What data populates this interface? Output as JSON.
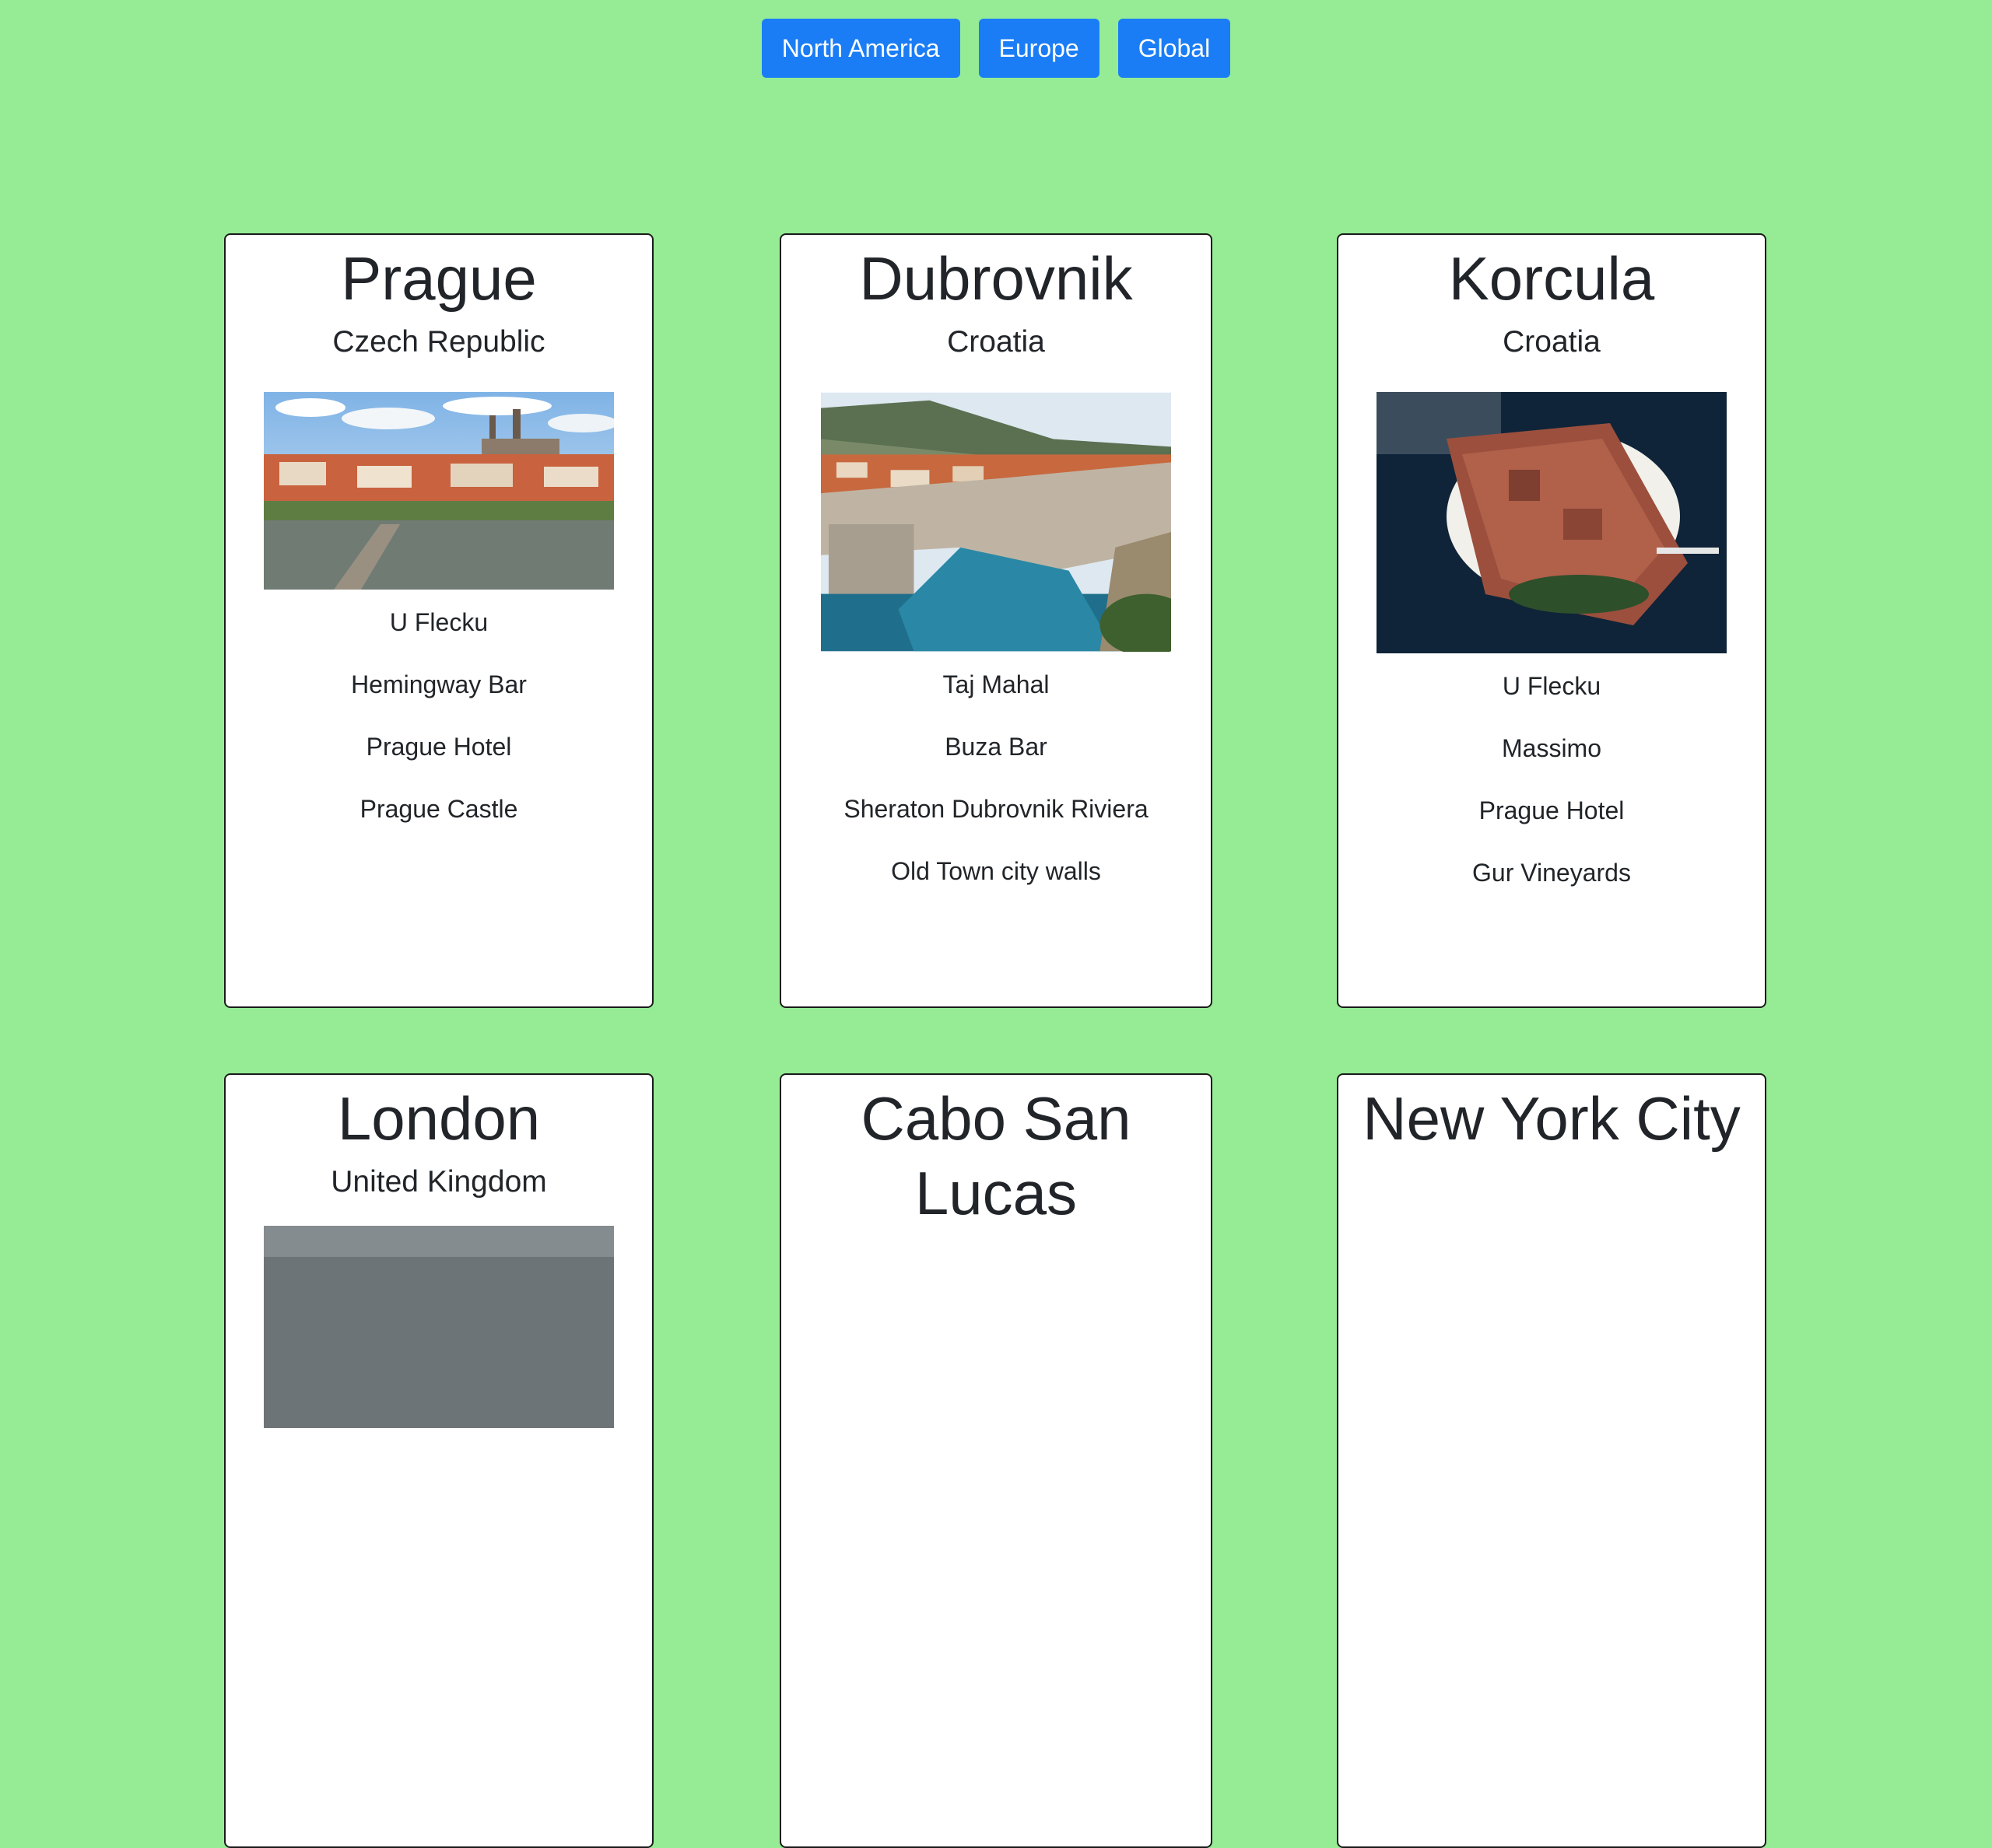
{
  "nav": {
    "buttons": [
      {
        "label": "North America"
      },
      {
        "label": "Europe"
      },
      {
        "label": "Global"
      }
    ]
  },
  "cards": [
    {
      "city": "Prague",
      "country": "Czech Republic",
      "places": [
        "U Flecku",
        "Hemingway Bar",
        "Prague Hotel",
        "Prague Castle"
      ]
    },
    {
      "city": "Dubrovnik",
      "country": "Croatia",
      "places": [
        "Taj Mahal",
        "Buza Bar",
        "Sheraton Dubrovnik Riviera",
        "Old Town city walls"
      ]
    },
    {
      "city": "Korcula",
      "country": "Croatia",
      "places": [
        "U Flecku",
        "Massimo",
        "Prague Hotel",
        "Gur Vineyards"
      ]
    },
    {
      "city": "London",
      "country": "United Kingdom",
      "places": []
    },
    {
      "city": "Cabo San Lucas",
      "country": "",
      "places": []
    },
    {
      "city": "New York City",
      "country": "",
      "places": []
    }
  ]
}
